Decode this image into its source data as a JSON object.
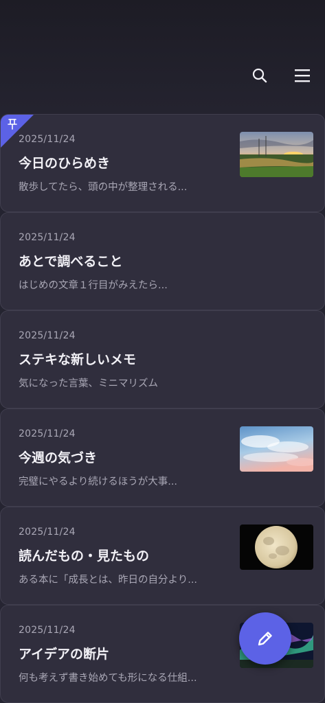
{
  "header": {
    "search_icon": "search-icon",
    "menu_icon": "hamburger-menu-icon"
  },
  "notes": [
    {
      "date": "2025/11/24",
      "title": "今日のひらめき",
      "preview": "散歩してたら、頭の中が整理される...",
      "pinned": true,
      "thumbnail": "sunset-field"
    },
    {
      "date": "2025/11/24",
      "title": "あとで調べること",
      "preview": "はじめの文章１行目がみえたら...",
      "pinned": false,
      "thumbnail": null
    },
    {
      "date": "2025/11/24",
      "title": "ステキな新しいメモ",
      "preview": "気になった言葉、ミニマリズム",
      "pinned": false,
      "thumbnail": null
    },
    {
      "date": "2025/11/24",
      "title": "今週の気づき",
      "preview": "完璧にやるより続けるほうが大事...",
      "pinned": false,
      "thumbnail": "sky-clouds"
    },
    {
      "date": "2025/11/24",
      "title": "読んだもの・見たもの",
      "preview": "ある本に「成長とは、昨日の自分より...",
      "pinned": false,
      "thumbnail": "full-moon"
    },
    {
      "date": "2025/11/24",
      "title": "アイデアの断片",
      "preview": "何も考えず書き始めても形になる仕組...",
      "pinned": false,
      "thumbnail": "aurora"
    }
  ],
  "fab": {
    "icon": "pencil-icon"
  },
  "colors": {
    "accent": "#5c62e6",
    "background": "#24232f",
    "card": "#302e3d"
  }
}
